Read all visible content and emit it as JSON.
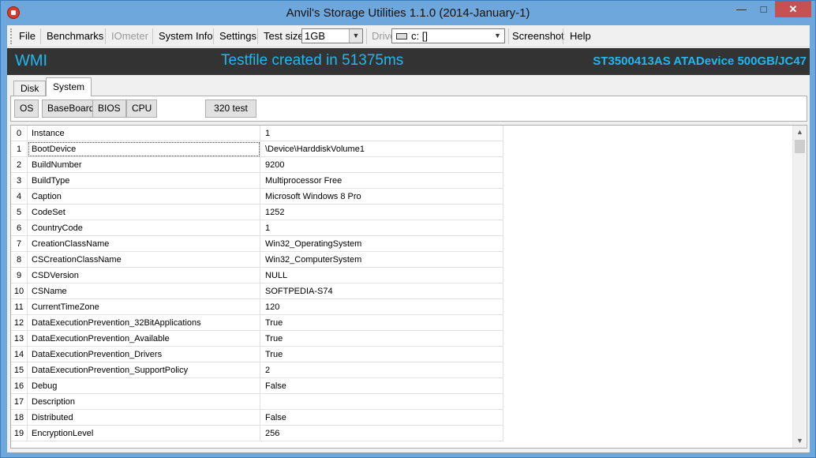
{
  "window": {
    "title": "Anvil's Storage Utilities 1.1.0 (2014-January-1)",
    "minimize_glyph": "—",
    "maximize_glyph": "□",
    "close_glyph": "✕"
  },
  "menu": {
    "file": "File",
    "benchmarks": "Benchmarks",
    "iometer": "IOmeter",
    "system_info": "System Info",
    "settings": "Settings",
    "test_size_label": "Test size",
    "test_size_value": "1GB",
    "drive_label": "Drive",
    "drive_value": "c: []",
    "screenshot": "Screenshot",
    "help": "Help",
    "dropdown_glyph": "▼"
  },
  "status": {
    "mode": "WMI",
    "message": "Testfile created in 51375ms",
    "device": "ST3500413AS ATADevice 500GB/JC47",
    "text_color": "#1fb8f0",
    "background": "#333333"
  },
  "tabs": [
    {
      "label": "Disk",
      "active": false
    },
    {
      "label": "System",
      "active": true
    }
  ],
  "system_buttons": {
    "os": "OS",
    "baseboard": "BaseBoard",
    "bios": "BIOS",
    "cpu": "CPU",
    "test320": "320 test"
  },
  "grid": {
    "rows": [
      {
        "idx": "0",
        "name": "Instance",
        "value": "1"
      },
      {
        "idx": "1",
        "name": "BootDevice",
        "value": "\\Device\\HarddiskVolume1"
      },
      {
        "idx": "2",
        "name": "BuildNumber",
        "value": "9200"
      },
      {
        "idx": "3",
        "name": "BuildType",
        "value": "Multiprocessor Free"
      },
      {
        "idx": "4",
        "name": "Caption",
        "value": "Microsoft Windows 8 Pro"
      },
      {
        "idx": "5",
        "name": "CodeSet",
        "value": "1252"
      },
      {
        "idx": "6",
        "name": "CountryCode",
        "value": "1"
      },
      {
        "idx": "7",
        "name": "CreationClassName",
        "value": "Win32_OperatingSystem"
      },
      {
        "idx": "8",
        "name": "CSCreationClassName",
        "value": "Win32_ComputerSystem"
      },
      {
        "idx": "9",
        "name": "CSDVersion",
        "value": "NULL"
      },
      {
        "idx": "10",
        "name": "CSName",
        "value": "SOFTPEDIA-S74"
      },
      {
        "idx": "11",
        "name": "CurrentTimeZone",
        "value": "120"
      },
      {
        "idx": "12",
        "name": "DataExecutionPrevention_32BitApplications",
        "value": "True"
      },
      {
        "idx": "13",
        "name": "DataExecutionPrevention_Available",
        "value": "True"
      },
      {
        "idx": "14",
        "name": "DataExecutionPrevention_Drivers",
        "value": "True"
      },
      {
        "idx": "15",
        "name": "DataExecutionPrevention_SupportPolicy",
        "value": "2"
      },
      {
        "idx": "16",
        "name": "Debug",
        "value": "False"
      },
      {
        "idx": "17",
        "name": "Description",
        "value": ""
      },
      {
        "idx": "18",
        "name": "Distributed",
        "value": "False"
      },
      {
        "idx": "19",
        "name": "EncryptionLevel",
        "value": "256"
      }
    ],
    "scroll_up_glyph": "▲",
    "scroll_down_glyph": "▼"
  }
}
